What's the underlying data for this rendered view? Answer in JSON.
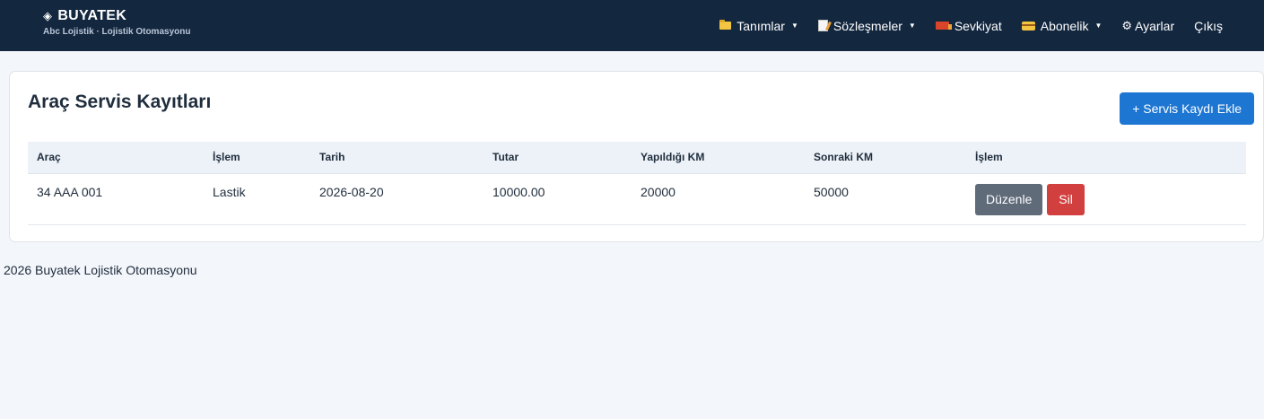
{
  "brand": {
    "title": "BUYATEK",
    "subtitle": "Abc Lojistik · Lojistik Otomasyonu",
    "icon": "diamond-icon"
  },
  "nav": {
    "tanimlar": "Tanımlar",
    "sozlesmeler": "Sözleşmeler",
    "sevkiyat": "Sevkiyat",
    "abonelik": "Abonelik",
    "ayarlar": "Ayarlar",
    "cikis": "Çıkış",
    "icons": [
      "folder-icon",
      "memo-icon",
      "truck-icon",
      "card-icon",
      "gear-icon"
    ]
  },
  "page": {
    "title": "Araç Servis Kayıtları",
    "add_button": "+ Servis Kaydı Ekle"
  },
  "table": {
    "headers": [
      "Araç",
      "İşlem",
      "Tarih",
      "Tutar",
      "Yapıldığı KM",
      "Sonraki KM",
      "İşlem"
    ],
    "rows": [
      {
        "arac": "34 AAA 001",
        "islem": "Lastik",
        "tarih": "2026-08-20",
        "tutar": "10000.00",
        "yapildigi_km": "20000",
        "sonraki_km": "50000",
        "edit_label": "Düzenle",
        "delete_label": "Sil"
      }
    ]
  },
  "footer": {
    "text": "2026 Buyatek Lojistik Otomasyonu"
  },
  "colors": {
    "topbar": "#13273f",
    "primary": "#1d76d2",
    "edit": "#5f6b79",
    "delete": "#d23f3f",
    "background": "#f3f6fa"
  }
}
